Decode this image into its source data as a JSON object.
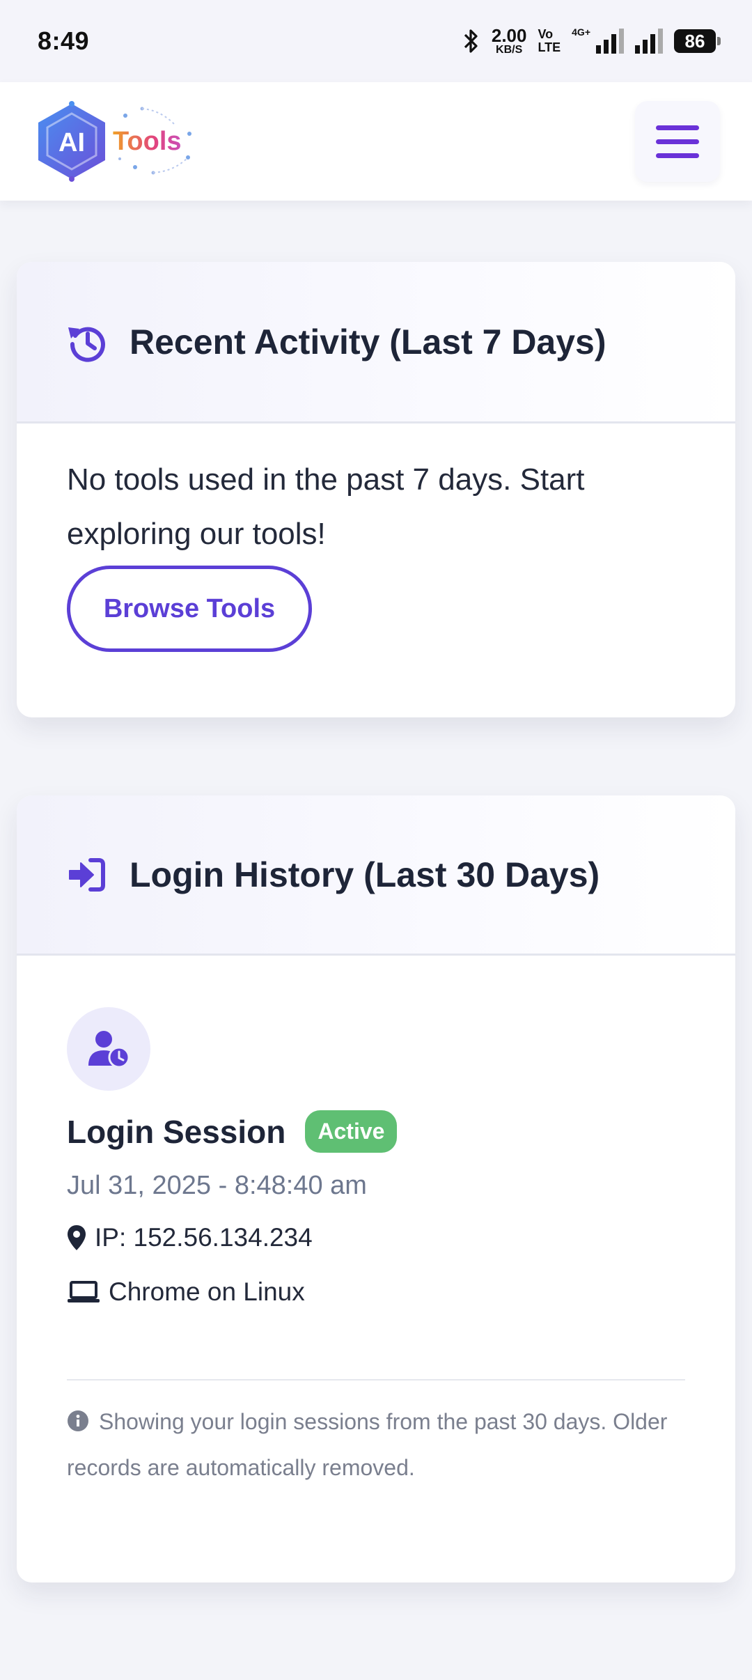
{
  "status_bar": {
    "time": "8:49",
    "net_speed_value": "2.00",
    "net_speed_unit": "KB/S",
    "volte_top": "Vo",
    "volte_bottom": "LTE",
    "network_type": "4G+",
    "battery": "86"
  },
  "header": {
    "logo_letters": "AI",
    "logo_text": "Tools",
    "menu_icon": "hamburger-icon"
  },
  "recent_activity": {
    "title": "Recent Activity (Last 7 Days)",
    "icon": "history-icon",
    "empty_message": "No tools used in the past 7 days. Start exploring our tools!",
    "browse_button": "Browse Tools"
  },
  "login_history": {
    "title": "Login History (Last 30 Days)",
    "icon": "sign-in-icon",
    "sessions": [
      {
        "title": "Login Session",
        "status": "Active",
        "datetime": "Jul 31, 2025 - 8:48:40 am",
        "ip": "IP: 152.56.134.234",
        "device": "Chrome on Linux"
      }
    ],
    "note": "Showing your login sessions from the past 30 days. Older records are automatically removed."
  },
  "colors": {
    "accent": "#5b3fd6",
    "menu": "#6a32d8",
    "active_badge": "#5fbf73"
  }
}
